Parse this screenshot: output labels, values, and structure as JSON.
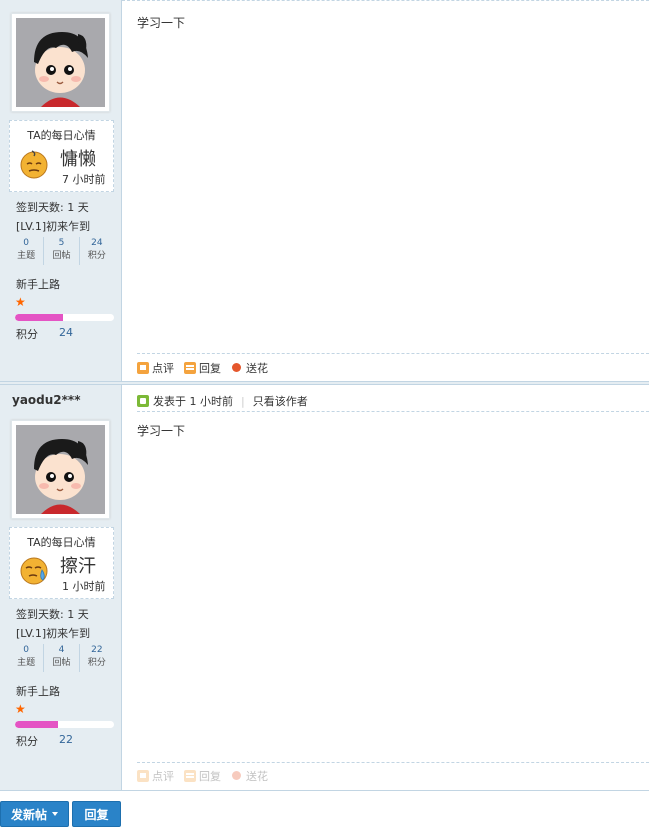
{
  "posts": [
    {
      "author": "",
      "mood": {
        "title": "TA的每日心情",
        "text": "慵懒",
        "time": "7 小时前",
        "face_icon": "lazy-face-icon"
      },
      "sign_days": "签到天数: 1 天",
      "level": "[LV.1]初来乍到",
      "stats": [
        {
          "value": "0",
          "label": "主题"
        },
        {
          "value": "5",
          "label": "回帖"
        },
        {
          "value": "24",
          "label": "积分"
        }
      ],
      "rank": "新手上路",
      "score_label": "积分",
      "score_value": "24",
      "score_progress": 0.48,
      "meta": null,
      "body": "学习一下",
      "actions": [
        "点评",
        "回复",
        "送花"
      ]
    },
    {
      "author": "yaodu2***",
      "mood": {
        "title": "TA的每日心情",
        "text": "擦汗",
        "time": "1 小时前",
        "face_icon": "sweat-face-icon"
      },
      "sign_days": "签到天数: 1 天",
      "level": "[LV.1]初来乍到",
      "stats": [
        {
          "value": "0",
          "label": "主题"
        },
        {
          "value": "4",
          "label": "回帖"
        },
        {
          "value": "22",
          "label": "积分"
        }
      ],
      "rank": "新手上路",
      "score_label": "积分",
      "score_value": "22",
      "score_progress": 0.43,
      "meta": {
        "posted": "发表于 1 小时前",
        "only_author": "只看该作者"
      },
      "body": "学习一下",
      "actions": [
        "点评",
        "回复",
        "送花"
      ]
    }
  ],
  "footer": {
    "new_post": "发新帖",
    "reply": "回复"
  },
  "colors": {
    "accent": "#2a83c8",
    "sidebar_bg": "#e5edf2",
    "progress": "#e454c4",
    "link": "#336699"
  }
}
